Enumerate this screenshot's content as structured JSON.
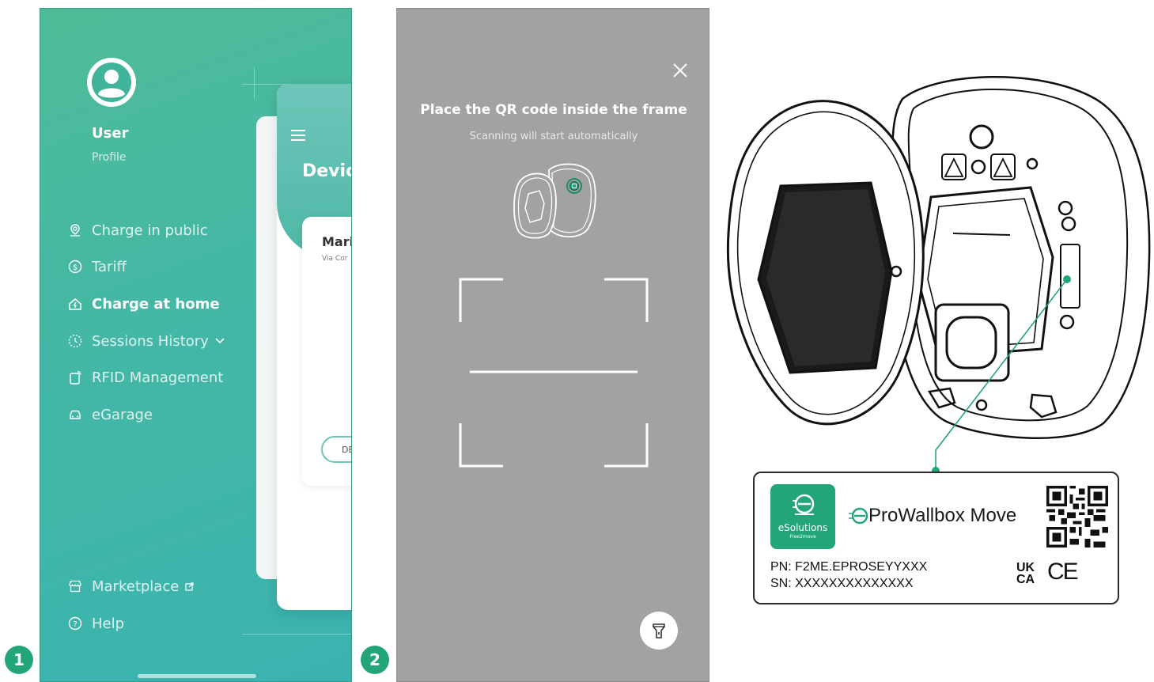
{
  "steps": [
    "1",
    "2"
  ],
  "screen1": {
    "user_name": "User",
    "user_sub": "Profile",
    "menu": [
      {
        "label": "Charge in public",
        "icon": "location-pin-icon",
        "active": false
      },
      {
        "label": "Tariff",
        "icon": "dollar-coin-icon",
        "active": false
      },
      {
        "label": "Charge at home",
        "icon": "home-charge-icon",
        "active": true
      },
      {
        "label": "Sessions History",
        "icon": "history-icon",
        "active": false
      },
      {
        "label": "RFID Management",
        "icon": "rfid-card-icon",
        "active": false
      },
      {
        "label": "eGarage",
        "icon": "car-icon",
        "active": false
      }
    ],
    "bottom_menu": [
      {
        "label": "Marketplace",
        "icon": "store-icon"
      },
      {
        "label": "Help",
        "icon": "help-circle-icon"
      }
    ],
    "card": {
      "title": "Devic",
      "item_name": "Mari",
      "item_sub": "Via Cor",
      "button": "DE"
    }
  },
  "screen2": {
    "title": "Place the QR code inside the frame",
    "subtitle": "Scanning will start automatically"
  },
  "label": {
    "brand": "eSolutions",
    "brand_sub": "Free2move",
    "product": "ProWallbox Move",
    "pn": "PN: F2ME.EPROSEYYXXX",
    "sn": "SN: XXXXXXXXXXXXXX",
    "ukca_top": "UK",
    "ukca_bottom": "CA",
    "ce": "CE"
  },
  "colors": {
    "brand_green": "#22a57a",
    "menu_gradient_top": "#4fbc98",
    "menu_gradient_bottom": "#3ab3b0",
    "scanner_bg": "#a2a2a2"
  }
}
